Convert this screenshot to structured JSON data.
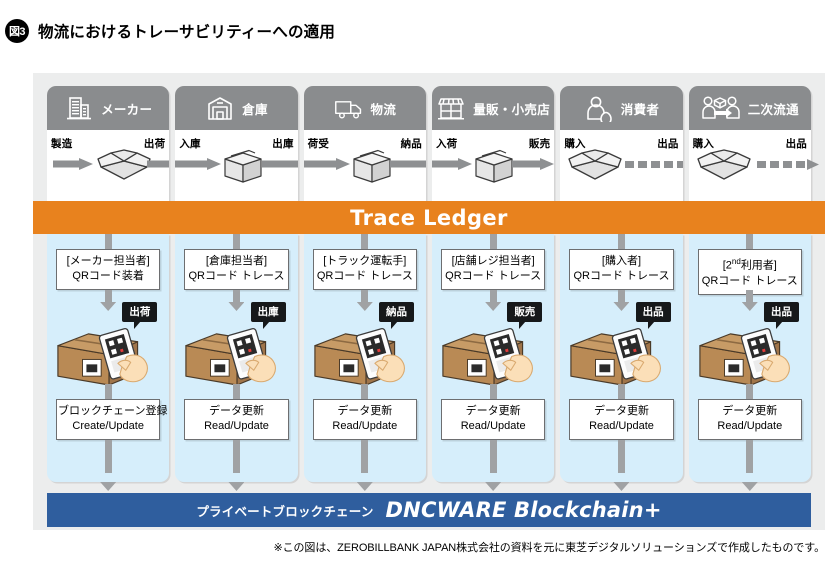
{
  "title": {
    "badge": "図3",
    "text": "物流におけるトレーサビリティーへの適用"
  },
  "colors": {
    "header_gray": "#8a8c8e",
    "trace_ledger_orange": "#e8821e",
    "panel_blue": "#d6eefb",
    "blockchain_blue": "#2f5e9e",
    "frame_gray": "#eceded",
    "arrow_gray": "#a0a2a4"
  },
  "stages": [
    {
      "header_label": "メーカー",
      "header_icon": "factory-building-icon",
      "flow_left_label": "製造",
      "flow_right_label": "出荷",
      "role_line1": "[メーカー担当者]",
      "role_line2": "QRコード装着",
      "scan_tag": "出荷",
      "illustration_icon": "qr-scan-box-icon",
      "data_line1": "ブロックチェーン登録",
      "data_line2": "Create/Update"
    },
    {
      "header_label": "倉庫",
      "header_icon": "warehouse-icon",
      "flow_left_label": "入庫",
      "flow_right_label": "出庫",
      "role_line1": "[倉庫担当者]",
      "role_line2": "QRコード トレース",
      "scan_tag": "出庫",
      "illustration_icon": "qr-scan-box-icon",
      "data_line1": "データ更新",
      "data_line2": "Read/Update"
    },
    {
      "header_label": "物流",
      "header_icon": "truck-icon",
      "flow_left_label": "荷受",
      "flow_right_label": "納品",
      "role_line1": "[トラック運転手]",
      "role_line2": "QRコード トレース",
      "scan_tag": "納品",
      "illustration_icon": "qr-scan-box-icon",
      "data_line1": "データ更新",
      "data_line2": "Read/Update"
    },
    {
      "header_label": "量販・小売店",
      "header_icon": "storefront-icon",
      "flow_left_label": "入荷",
      "flow_right_label": "販売",
      "role_line1": "[店舗レジ担当者]",
      "role_line2": "QRコード トレース",
      "scan_tag": "販売",
      "illustration_icon": "qr-scan-box-icon",
      "data_line1": "データ更新",
      "data_line2": "Read/Update"
    },
    {
      "header_label": "消費者",
      "header_icon": "consumer-person-icon",
      "flow_left_label": "購入",
      "flow_right_label": "出品",
      "role_line1": "[購入者]",
      "role_line2": "QRコード トレース",
      "scan_tag": "出品",
      "illustration_icon": "qr-scan-box-icon",
      "data_line1": "データ更新",
      "data_line2": "Read/Update"
    },
    {
      "header_label": "二次流通",
      "header_icon": "person-to-person-handover-icon",
      "flow_left_label": "購入",
      "flow_right_label": "出品",
      "role_line1_prefix": "[2",
      "role_line1_sup": "nd",
      "role_line1_suffix": "利用者]",
      "role_line1": "[2nd 利用者]",
      "role_line2": "QRコード トレース",
      "scan_tag": "出品",
      "illustration_icon": "qr-scan-box-icon",
      "data_line1": "データ更新",
      "data_line2": "Read/Update"
    }
  ],
  "trace_ledger": {
    "label": "Trace Ledger"
  },
  "blockchain_bar": {
    "left_label": "プライベートブロックチェーン",
    "right_label": "DNCWARE Blockchain+"
  },
  "footnote": {
    "text": "※この図は、ZEROBILLBANK JAPAN株式会社の資料を元に東芝デジタルソリューションズで作成したものです。"
  }
}
